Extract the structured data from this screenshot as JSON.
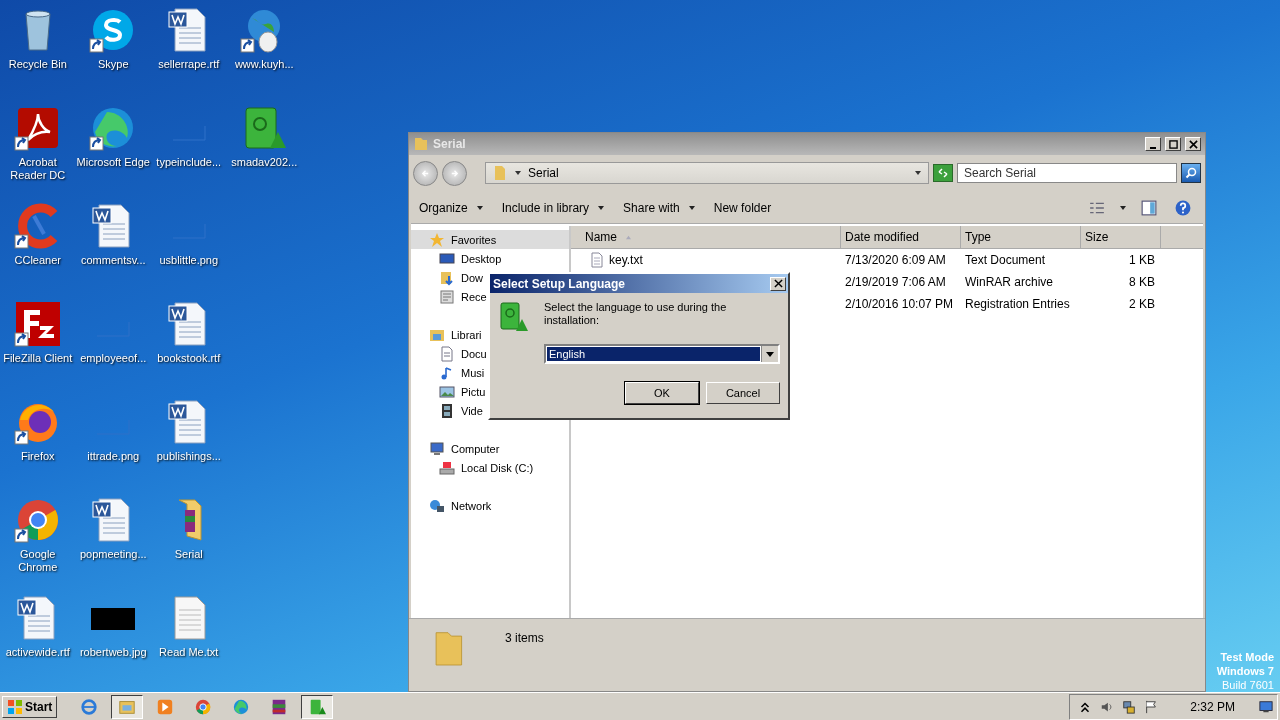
{
  "desktop_icons": [
    {
      "label": "Recycle Bin",
      "kind": "recycle",
      "shortcut": false
    },
    {
      "label": "Acrobat Reader DC",
      "kind": "acrobat",
      "shortcut": true
    },
    {
      "label": "CCleaner",
      "kind": "ccleaner",
      "shortcut": true
    },
    {
      "label": "FileZilla Client",
      "kind": "filezilla",
      "shortcut": true
    },
    {
      "label": "Firefox",
      "kind": "firefox",
      "shortcut": true
    },
    {
      "label": "Google Chrome",
      "kind": "chrome",
      "shortcut": true
    },
    {
      "label": "activewide.rtf",
      "kind": "word",
      "shortcut": false
    },
    {
      "label": "Skype",
      "kind": "skype",
      "shortcut": true
    },
    {
      "label": "Microsoft Edge",
      "kind": "edge",
      "shortcut": true
    },
    {
      "label": "commentsv...",
      "kind": "word",
      "shortcut": false
    },
    {
      "label": "employeeof...",
      "kind": "thumb",
      "shortcut": false
    },
    {
      "label": "ittrade.png",
      "kind": "thumb",
      "shortcut": false
    },
    {
      "label": "popmeeting...",
      "kind": "word",
      "shortcut": false
    },
    {
      "label": "robertweb.jpg",
      "kind": "dark",
      "shortcut": false
    },
    {
      "label": "sellerrape.rtf",
      "kind": "word",
      "shortcut": false
    },
    {
      "label": "typeinclude...",
      "kind": "thumb",
      "shortcut": false
    },
    {
      "label": "usblittle.png",
      "kind": "thumb",
      "shortcut": false
    },
    {
      "label": "bookstook.rtf",
      "kind": "word",
      "shortcut": false
    },
    {
      "label": "publishings...",
      "kind": "word",
      "shortcut": false
    },
    {
      "label": "Serial",
      "kind": "folder",
      "shortcut": false
    },
    {
      "label": "Read Me.txt",
      "kind": "text",
      "shortcut": false
    },
    {
      "label": "www.kuyh...",
      "kind": "globe",
      "shortcut": true
    },
    {
      "label": "smadav202...",
      "kind": "smadav",
      "shortcut": false
    }
  ],
  "explorer": {
    "title": "Serial",
    "address": "Serial",
    "search": {
      "placeholder": "Search Serial"
    },
    "commands": [
      {
        "label": "Organize",
        "menu": true
      },
      {
        "label": "Include in library",
        "menu": true
      },
      {
        "label": "Share with",
        "menu": true
      },
      {
        "label": "New folder",
        "menu": false
      }
    ],
    "nav": [
      {
        "label": "Favorites",
        "selected": true,
        "children": [
          {
            "label": "Desktop",
            "selected": false
          },
          {
            "label": "Dow",
            "selected": false
          },
          {
            "label": "Rece",
            "selected": false
          }
        ]
      },
      {
        "label": "Librari",
        "selected": false,
        "children": [
          {
            "label": "Docu",
            "selected": false
          },
          {
            "label": "Musi",
            "selected": false
          },
          {
            "label": "Pictu",
            "selected": false
          },
          {
            "label": "Vide",
            "selected": false
          }
        ]
      },
      {
        "label": "Computer",
        "selected": false,
        "children": [
          {
            "label": "Local Disk (C:)",
            "selected": false
          }
        ]
      },
      {
        "label": "Network",
        "selected": false
      }
    ],
    "columns": [
      "Name",
      "Date modified",
      "Type",
      "Size"
    ],
    "rows": [
      {
        "name": "key.txt",
        "date": "7/13/2020 6:09 AM",
        "type": "Text Document",
        "size": "1 KB"
      },
      {
        "date": "2/19/2019 7:06 AM",
        "type": "WinRAR archive",
        "size": "8 KB"
      },
      {
        "date": "2/10/2016 10:07 PM",
        "type": "Registration Entries",
        "size": "2 KB"
      }
    ],
    "status": "3 items"
  },
  "dialog": {
    "title": "Select Setup Language",
    "message": "Select the language to use during the installation:",
    "language": "English",
    "buttons": [
      {
        "label": "OK",
        "default": true
      },
      {
        "label": "Cancel",
        "default": false
      }
    ]
  },
  "watermark_text": [
    "Test Mode",
    "Windows 7",
    "Build 7601"
  ],
  "taskbar": {
    "start": "Start",
    "items": [
      {
        "kind": "ie",
        "selected": false
      },
      {
        "kind": "explorer",
        "selected": true
      },
      {
        "kind": "media",
        "selected": false
      },
      {
        "kind": "chrome",
        "selected": false
      },
      {
        "kind": "edge",
        "selected": false
      },
      {
        "kind": "winrar",
        "selected": false
      },
      {
        "kind": "smadav",
        "selected": true
      }
    ],
    "time": "2:32 PM"
  }
}
